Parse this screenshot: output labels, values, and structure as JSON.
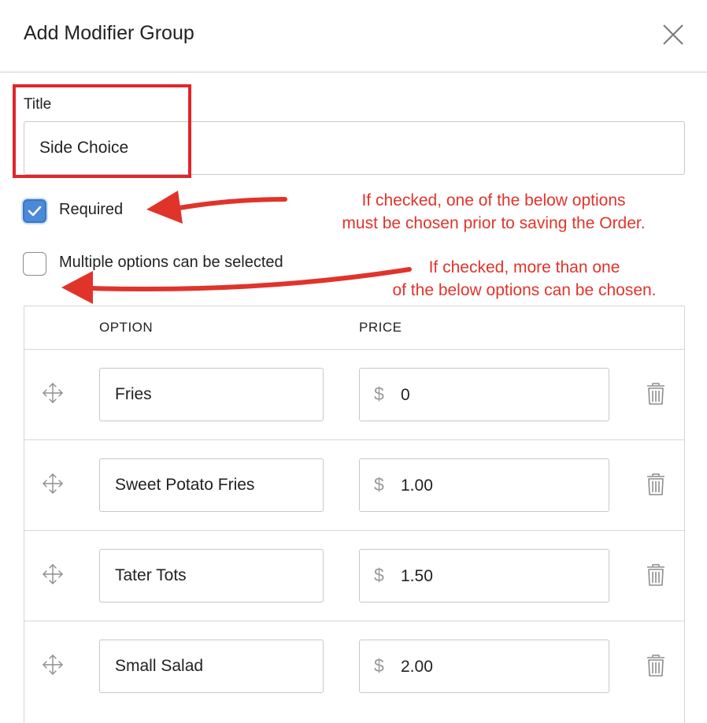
{
  "dialog": {
    "title": "Add Modifier Group",
    "close_icon": "close-icon"
  },
  "title_field": {
    "label": "Title",
    "value": "Side Choice"
  },
  "required": {
    "label": "Required",
    "checked": true
  },
  "multiple": {
    "label": "Multiple options can be selected",
    "checked": false
  },
  "annotations": {
    "required_line1": "If checked, one of the below options",
    "required_line2": "must be chosen prior to saving the Order.",
    "multiple_line1": "If checked, more than one",
    "multiple_line2": "of the below options can be chosen.",
    "color": "#e0342b"
  },
  "table": {
    "headers": {
      "option": "OPTION",
      "price": "PRICE"
    },
    "currency_symbol": "$",
    "rows": [
      {
        "option": "Fries",
        "price": "0"
      },
      {
        "option": "Sweet Potato Fries",
        "price": "1.00"
      },
      {
        "option": "Tater Tots",
        "price": "1.50"
      },
      {
        "option": "Small Salad",
        "price": "2.00"
      }
    ],
    "row_icons": {
      "drag": "move-icon",
      "delete": "trash-icon"
    }
  },
  "colors": {
    "accent": "#4a8ad8",
    "highlight": "#e0262b"
  }
}
